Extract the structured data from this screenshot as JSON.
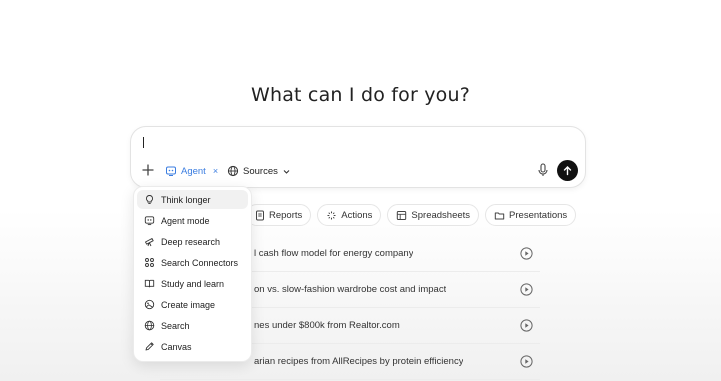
{
  "headline": "What can I do for you?",
  "composer": {
    "agent_label": "Agent",
    "agent_close": "×",
    "sources_label": "Sources"
  },
  "chips": [
    {
      "label": "Reports",
      "icon": "document-icon"
    },
    {
      "label": "Actions",
      "icon": "sparkle-icon"
    },
    {
      "label": "Spreadsheets",
      "icon": "table-icon"
    },
    {
      "label": "Presentations",
      "icon": "folder-icon"
    }
  ],
  "suggestions": [
    "l cash flow model for energy company",
    "on vs. slow-fashion wardrobe cost and impact",
    "nes under $800k from Realtor.com",
    "arian recipes from AllRecipes by protein efficiency"
  ],
  "menu": [
    {
      "label": "Think longer",
      "icon": "lightbulb-icon",
      "active": true
    },
    {
      "label": "Agent mode",
      "icon": "agent-icon"
    },
    {
      "label": "Deep research",
      "icon": "telescope-icon"
    },
    {
      "label": "Search Connectors",
      "icon": "connectors-icon"
    },
    {
      "label": "Study and learn",
      "icon": "book-icon"
    },
    {
      "label": "Create image",
      "icon": "image-icon"
    },
    {
      "label": "Search",
      "icon": "globe-icon"
    },
    {
      "label": "Canvas",
      "icon": "canvas-icon"
    }
  ],
  "colors": {
    "accent": "#3b7de0",
    "send_button": "#111111"
  }
}
